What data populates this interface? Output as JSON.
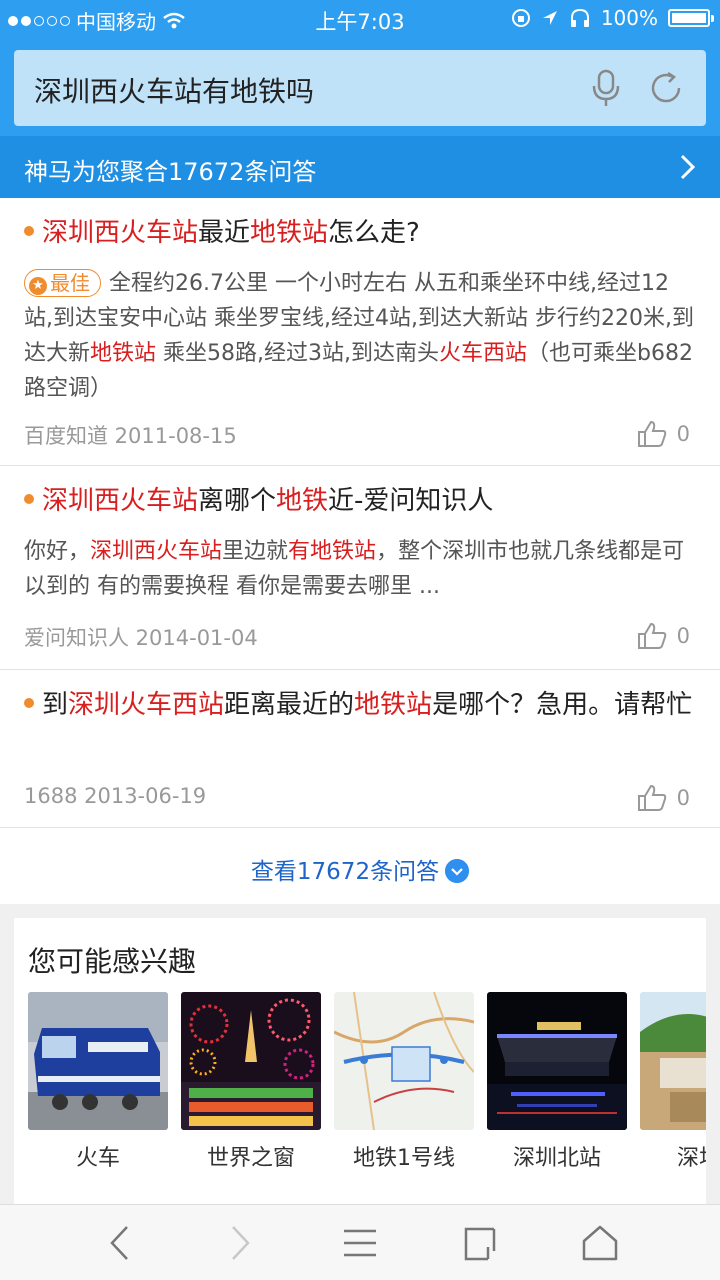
{
  "status": {
    "carrier": "中国移动",
    "time": "上午7:03",
    "battery": "100%"
  },
  "search": {
    "query": "深圳西火车站有地铁吗"
  },
  "aggregate": {
    "label": "神马为您聚合17672条问答"
  },
  "results": [
    {
      "title": [
        {
          "t": "深圳西火车站",
          "hl": true
        },
        {
          "t": "最近",
          "hl": false
        },
        {
          "t": "地铁站",
          "hl": true
        },
        {
          "t": "怎么走?",
          "hl": false
        }
      ],
      "badge": "最佳",
      "snippet": [
        {
          "t": "全程约26.7公里 一个小时左右 从五和乘坐环中线,经过12站,到达宝安中心站 乘坐罗宝线,经过4站,到达大新站 步行约220米,到达大新",
          "hl": false
        },
        {
          "t": "地铁站",
          "hl": true
        },
        {
          "t": " 乘坐58路,经过3站,到达南头",
          "hl": false
        },
        {
          "t": "火车西站",
          "hl": true
        },
        {
          "t": "（也可乘坐b682路空调）",
          "hl": false
        }
      ],
      "source": "百度知道 2011-08-15",
      "likes": "0"
    },
    {
      "title": [
        {
          "t": "深圳西火车站",
          "hl": true
        },
        {
          "t": "离哪个",
          "hl": false
        },
        {
          "t": "地铁",
          "hl": true
        },
        {
          "t": "近-爱问知识人",
          "hl": false
        }
      ],
      "snippet": [
        {
          "t": "你好，",
          "hl": false
        },
        {
          "t": "深圳西火车站",
          "hl": true
        },
        {
          "t": "里边就",
          "hl": false
        },
        {
          "t": "有地铁站",
          "hl": true
        },
        {
          "t": "，整个深圳市也就几条线都是可以到的 有的需要换程 看你是需要去哪里 ...",
          "hl": false
        }
      ],
      "source": "爱问知识人 2014-01-04",
      "likes": "0"
    },
    {
      "title": [
        {
          "t": "到",
          "hl": false
        },
        {
          "t": "深圳火车西站",
          "hl": true
        },
        {
          "t": "距离最近的",
          "hl": false
        },
        {
          "t": "地铁站",
          "hl": true
        },
        {
          "t": "是哪个？急用。请帮忙",
          "hl": false
        }
      ],
      "source": "1688 2013-06-19",
      "likes": "0"
    }
  ],
  "more": {
    "label": "查看17672条问答"
  },
  "interest": {
    "heading": "您可能感兴趣",
    "items": [
      {
        "label": "火车"
      },
      {
        "label": "世界之窗"
      },
      {
        "label": "地铁1号线"
      },
      {
        "label": "深圳北站"
      },
      {
        "label": "深圳火"
      }
    ]
  },
  "colors": {
    "brand_blue": "#2e9ff0",
    "bar_blue": "#1f8fe3",
    "highlight_red": "#d81e1e",
    "bullet_orange": "#f08c2e",
    "link_blue": "#1f64c8"
  }
}
